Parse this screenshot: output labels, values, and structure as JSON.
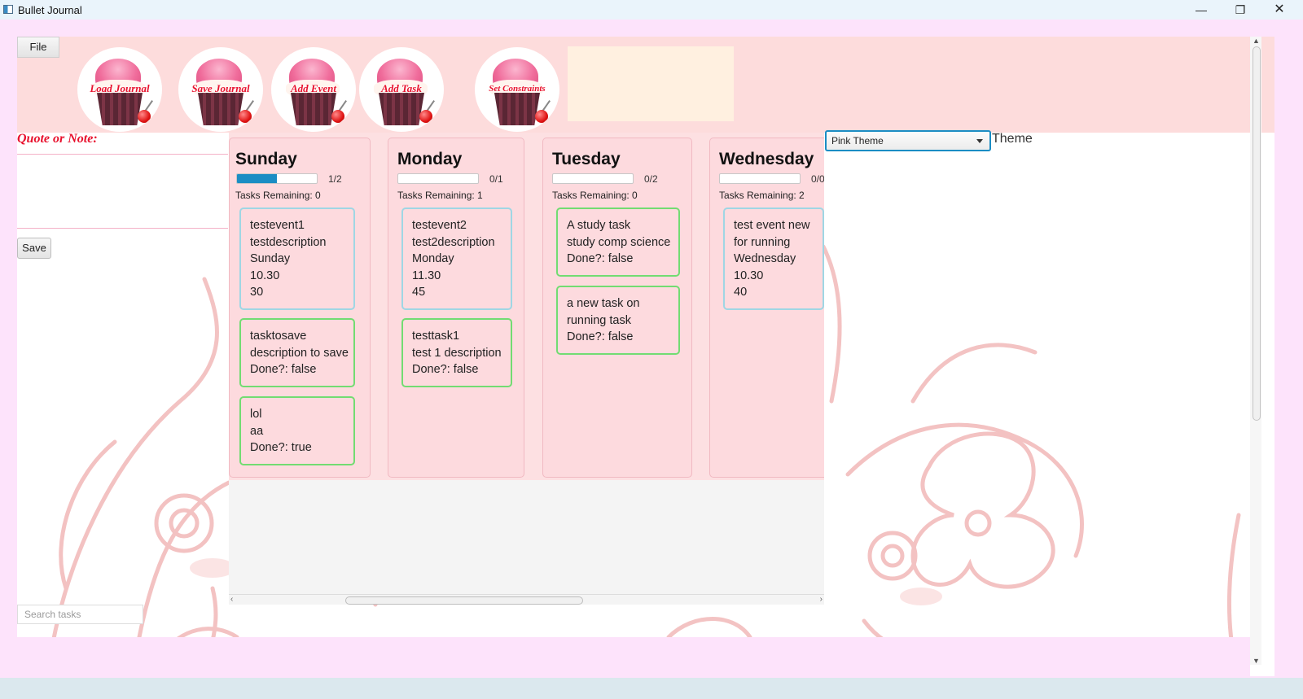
{
  "window": {
    "title": "Bullet Journal",
    "minimize": "—",
    "maximize": "❐",
    "close": "✕"
  },
  "menu": {
    "file": "File"
  },
  "toolbar": {
    "buttons": [
      {
        "label": "Load Journal"
      },
      {
        "label": "Save Journal"
      },
      {
        "label": "Add Event"
      },
      {
        "label": "Add Task"
      },
      {
        "label": "Set Constraints"
      }
    ]
  },
  "left": {
    "quote_label": "Quote or Note:",
    "quote_value": "",
    "save": "Save",
    "search_placeholder": "Search tasks"
  },
  "days": [
    {
      "name": "Sunday",
      "progress": 0.5,
      "progress_text": "1/2",
      "remaining": "Tasks Remaining: 0",
      "cards": [
        {
          "kind": "event",
          "lines": [
            "testevent1",
            "testdescription",
            "Sunday",
            "10.30",
            "30"
          ]
        },
        {
          "kind": "task",
          "lines": [
            "tasktosave",
            "description to save",
            "Done?: false"
          ]
        },
        {
          "kind": "task",
          "lines": [
            "lol",
            "aa",
            "Done?: true"
          ]
        }
      ]
    },
    {
      "name": "Monday",
      "progress": 0,
      "progress_text": "0/1",
      "remaining": "Tasks Remaining: 1",
      "cards": [
        {
          "kind": "event",
          "lines": [
            "testevent2",
            "test2description",
            "Monday",
            "11.30",
            "45"
          ]
        },
        {
          "kind": "task",
          "lines": [
            "testtask1",
            "test 1 description",
            "Done?: false"
          ]
        }
      ]
    },
    {
      "name": "Tuesday",
      "progress": 0,
      "progress_text": "0/2",
      "remaining": "Tasks Remaining: 0",
      "cards": [
        {
          "kind": "task",
          "lines": [
            "A study task",
            "study comp science",
            "Done?: false"
          ]
        },
        {
          "kind": "task",
          "lines": [
            "a new task on",
            "running task",
            "Done?: false"
          ]
        }
      ]
    },
    {
      "name": "Wednesday",
      "progress": 0,
      "progress_text": "0/0",
      "remaining": "Tasks Remaining: 2",
      "cards": [
        {
          "kind": "event",
          "lines": [
            "test event new",
            "for running",
            "Wednesday",
            "10.30",
            "40"
          ]
        }
      ]
    }
  ],
  "theme": {
    "selected": "Pink Theme",
    "label": "Theme"
  },
  "colors": {
    "accent": "#1b8dc4",
    "event_border": "#9fd6e4",
    "task_border": "#72dc72",
    "cupcake_label": "#e8112d"
  }
}
